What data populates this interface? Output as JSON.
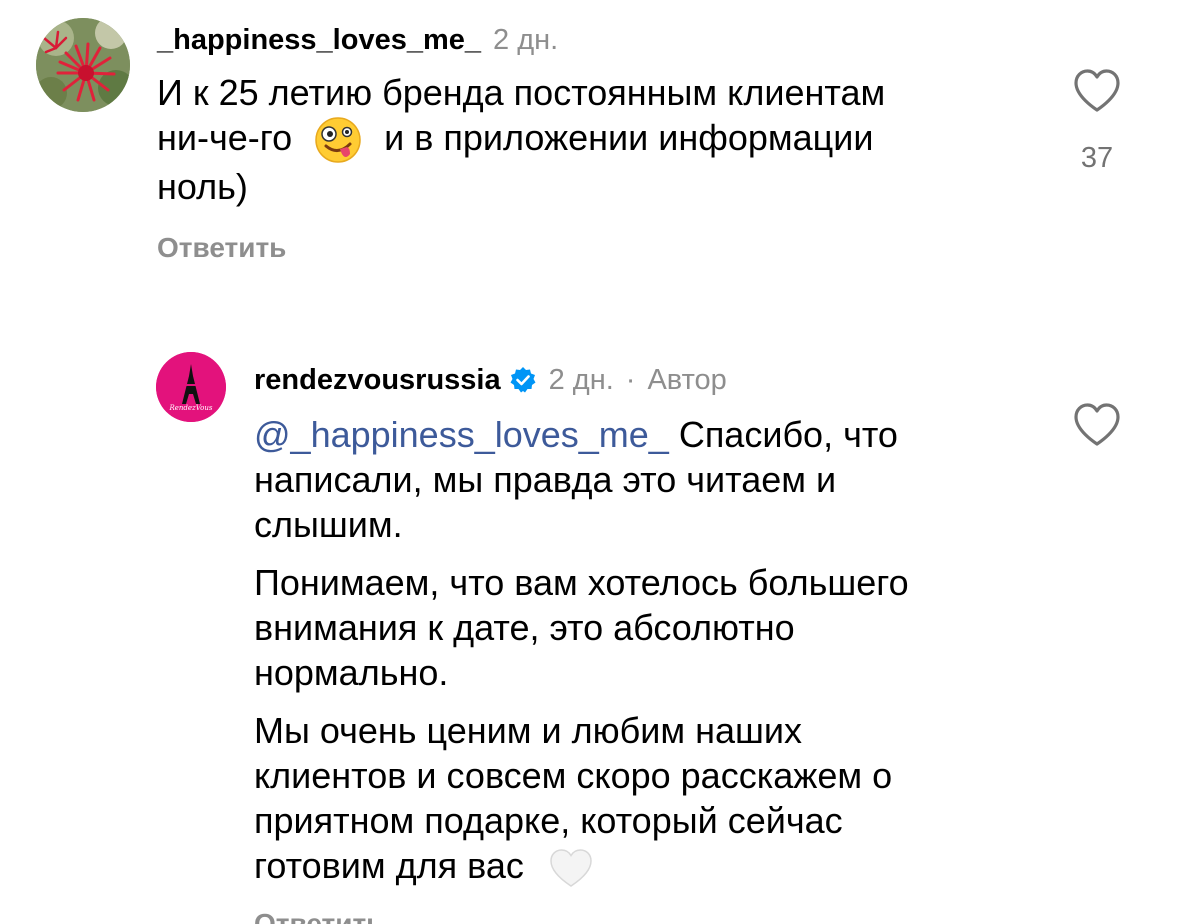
{
  "comment1": {
    "username": "_happiness_loves_me_",
    "time": "2 дн.",
    "text_line1": "И к 25 летию бренда постоянным клиентам",
    "text_line2_a": "ни-че-го",
    "text_line2_b": "и в приложении информации",
    "text_line3": "ноль)",
    "emoji_icon": "zany-face-emoji",
    "likes": "37",
    "reply_label": "Ответить"
  },
  "comment2": {
    "username": "rendezvousrussia",
    "verified_icon": "verified-badge-icon",
    "time": "2 дн.",
    "separator": "·",
    "author_label": "Автор",
    "avatar_text": "RendezVous",
    "mention": "@_happiness_loves_me_",
    "p1_line1_rest": " Спасибо, что",
    "p1_line2": "написали, мы правда это читаем и",
    "p1_line3": "слышим.",
    "p2_line1": "Понимаем, что вам хотелось большего",
    "p2_line2": "внимания к дате, это абсолютно",
    "p2_line3": "нормально.",
    "p3_line1": "Мы очень ценим и любим наших",
    "p3_line2": "клиентов и совсем скоро расскажем о",
    "p3_line3": "приятном подарке, который сейчас",
    "p3_line4": "готовим для вас",
    "heart_emoji": "white-heart-emoji",
    "reply_label": "Ответить"
  },
  "colors": {
    "meta_gray": "#8e8e8e",
    "mention_blue": "#3d5a9a",
    "brand_pink": "#e3127c"
  }
}
